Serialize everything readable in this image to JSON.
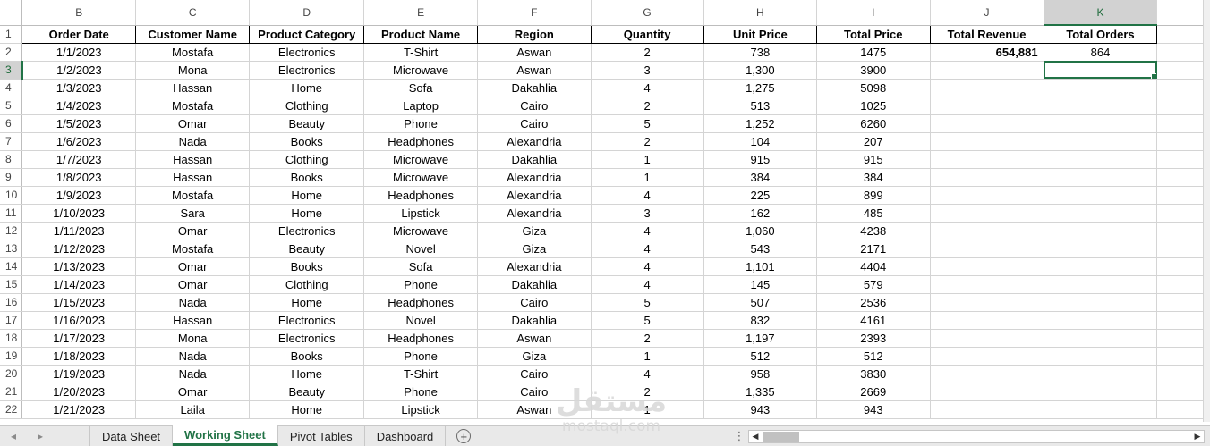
{
  "columns": [
    {
      "letter": "B",
      "width": 128
    },
    {
      "letter": "C",
      "width": 128
    },
    {
      "letter": "D",
      "width": 128
    },
    {
      "letter": "E",
      "width": 128
    },
    {
      "letter": "F",
      "width": 128
    },
    {
      "letter": "G",
      "width": 128
    },
    {
      "letter": "H",
      "width": 128
    },
    {
      "letter": "I",
      "width": 128
    },
    {
      "letter": "J",
      "width": 128
    },
    {
      "letter": "K",
      "width": 128
    }
  ],
  "headers": [
    "Order Date",
    "Customer Name",
    "Product Category",
    "Product Name",
    "Region",
    "Quantity",
    "Unit Price",
    "Total Price",
    "Total Revenue",
    "Total Orders"
  ],
  "summary": {
    "total_revenue": "654,881",
    "total_orders": "864"
  },
  "rows": [
    [
      "1/1/2023",
      "Mostafa",
      "Electronics",
      "T-Shirt",
      "Aswan",
      "2",
      "738",
      "1475"
    ],
    [
      "1/2/2023",
      "Mona",
      "Electronics",
      "Microwave",
      "Aswan",
      "3",
      "1,300",
      "3900"
    ],
    [
      "1/3/2023",
      "Hassan",
      "Home",
      "Sofa",
      "Dakahlia",
      "4",
      "1,275",
      "5098"
    ],
    [
      "1/4/2023",
      "Mostafa",
      "Clothing",
      "Laptop",
      "Cairo",
      "2",
      "513",
      "1025"
    ],
    [
      "1/5/2023",
      "Omar",
      "Beauty",
      "Phone",
      "Cairo",
      "5",
      "1,252",
      "6260"
    ],
    [
      "1/6/2023",
      "Nada",
      "Books",
      "Headphones",
      "Alexandria",
      "2",
      "104",
      "207"
    ],
    [
      "1/7/2023",
      "Hassan",
      "Clothing",
      "Microwave",
      "Dakahlia",
      "1",
      "915",
      "915"
    ],
    [
      "1/8/2023",
      "Hassan",
      "Books",
      "Microwave",
      "Alexandria",
      "1",
      "384",
      "384"
    ],
    [
      "1/9/2023",
      "Mostafa",
      "Home",
      "Headphones",
      "Alexandria",
      "4",
      "225",
      "899"
    ],
    [
      "1/10/2023",
      "Sara",
      "Home",
      "Lipstick",
      "Alexandria",
      "3",
      "162",
      "485"
    ],
    [
      "1/11/2023",
      "Omar",
      "Electronics",
      "Microwave",
      "Giza",
      "4",
      "1,060",
      "4238"
    ],
    [
      "1/12/2023",
      "Mostafa",
      "Beauty",
      "Novel",
      "Giza",
      "4",
      "543",
      "2171"
    ],
    [
      "1/13/2023",
      "Omar",
      "Books",
      "Sofa",
      "Alexandria",
      "4",
      "1,101",
      "4404"
    ],
    [
      "1/14/2023",
      "Omar",
      "Clothing",
      "Phone",
      "Dakahlia",
      "4",
      "145",
      "579"
    ],
    [
      "1/15/2023",
      "Nada",
      "Home",
      "Headphones",
      "Cairo",
      "5",
      "507",
      "2536"
    ],
    [
      "1/16/2023",
      "Hassan",
      "Electronics",
      "Novel",
      "Dakahlia",
      "5",
      "832",
      "4161"
    ],
    [
      "1/17/2023",
      "Mona",
      "Electronics",
      "Headphones",
      "Aswan",
      "2",
      "1,197",
      "2393"
    ],
    [
      "1/18/2023",
      "Nada",
      "Books",
      "Phone",
      "Giza",
      "1",
      "512",
      "512"
    ],
    [
      "1/19/2023",
      "Nada",
      "Home",
      "T-Shirt",
      "Cairo",
      "4",
      "958",
      "3830"
    ],
    [
      "1/20/2023",
      "Omar",
      "Beauty",
      "Phone",
      "Cairo",
      "2",
      "1,335",
      "2669"
    ],
    [
      "1/21/2023",
      "Laila",
      "Home",
      "Lipstick",
      "Aswan",
      "1",
      "943",
      "943"
    ]
  ],
  "selection": {
    "column": "K",
    "row": 3
  },
  "tabs": [
    {
      "label": "Data Sheet",
      "active": false
    },
    {
      "label": "Working Sheet",
      "active": true
    },
    {
      "label": "Pivot Tables",
      "active": false
    },
    {
      "label": "Dashboard",
      "active": false
    }
  ],
  "watermark": {
    "arabic": "مستقل",
    "latin": "mostaql.com"
  },
  "colors": {
    "accent": "#217346",
    "gridline": "#d4d4d4"
  },
  "icons": {
    "prev": "triangle-left-icon",
    "next": "triangle-right-icon",
    "add": "plus-circle-icon",
    "more": "ellipsis-icon"
  }
}
